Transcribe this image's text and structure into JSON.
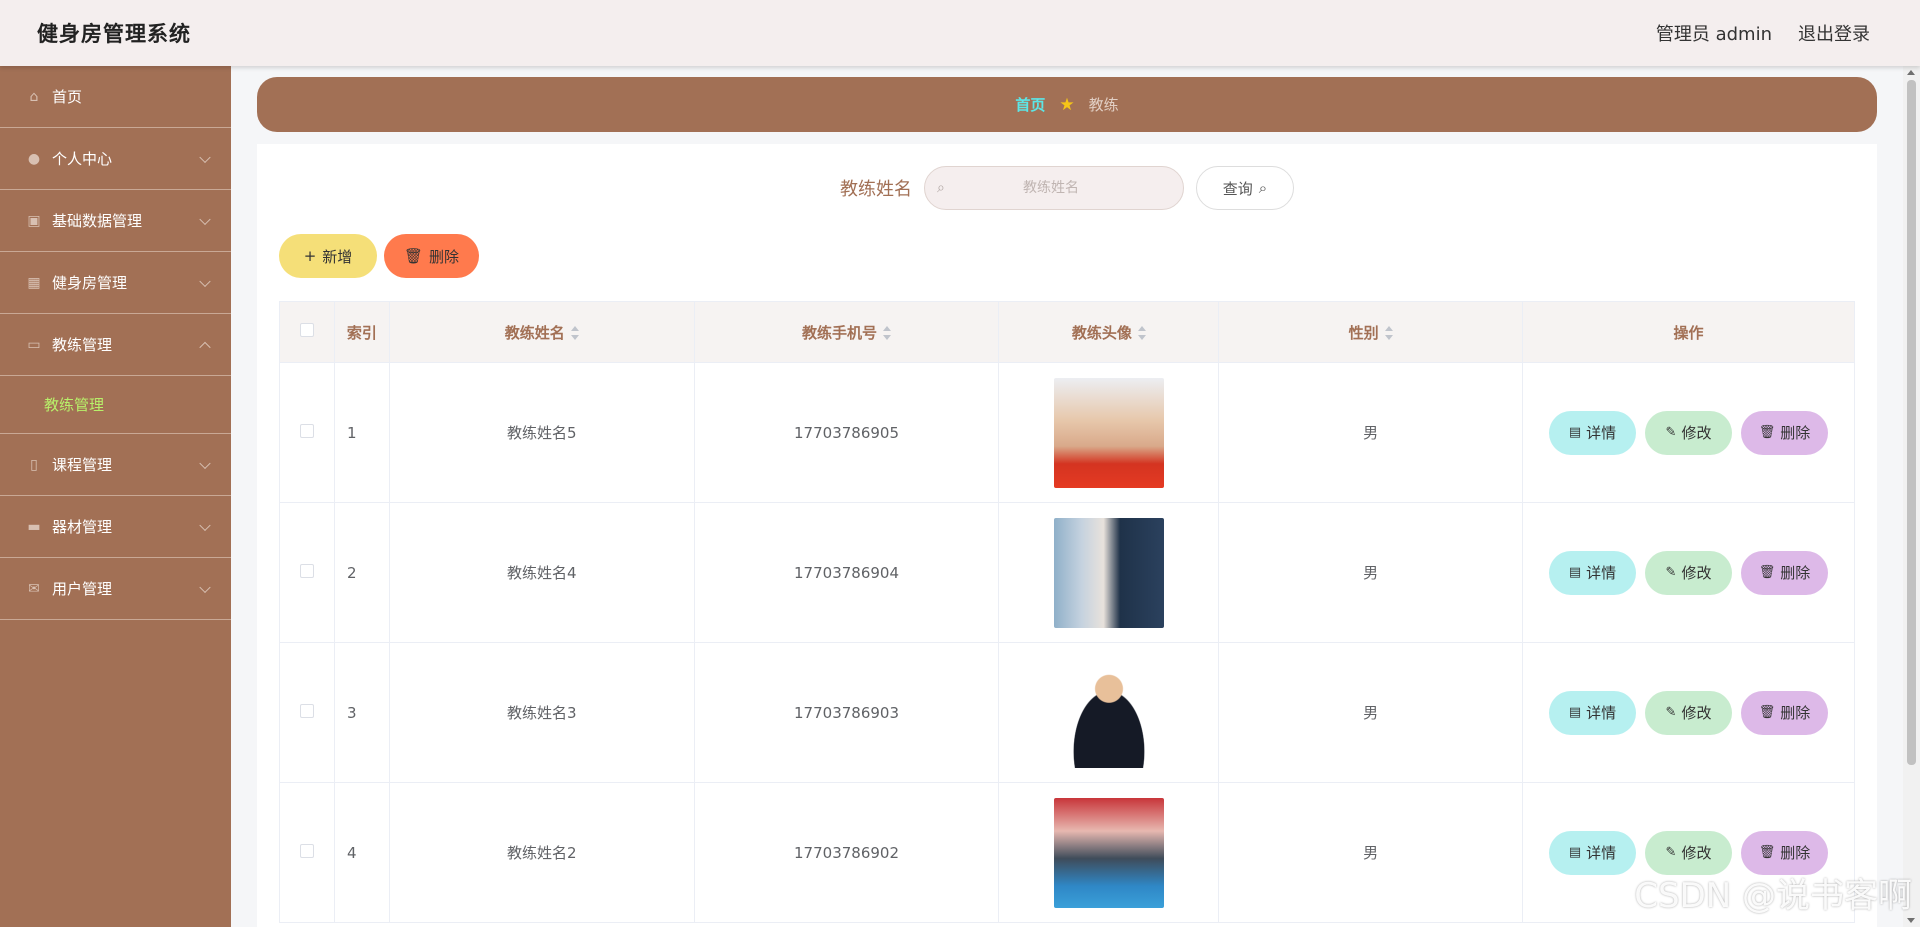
{
  "header": {
    "title": "健身房管理系统",
    "user": "管理员 admin",
    "logout": "退出登录"
  },
  "sidebar": {
    "items": [
      {
        "label": "首页",
        "icon": "home-icon"
      },
      {
        "label": "个人中心",
        "icon": "user-icon"
      },
      {
        "label": "基础数据管理",
        "icon": "briefcase-icon"
      },
      {
        "label": "健身房管理",
        "icon": "grid-icon"
      },
      {
        "label": "教练管理",
        "icon": "chat-icon"
      },
      {
        "label": "课程管理",
        "icon": "mic-icon"
      },
      {
        "label": "器材管理",
        "icon": "box-icon"
      },
      {
        "label": "用户管理",
        "icon": "mail-icon"
      }
    ],
    "submenu_active": "教练管理"
  },
  "breadcrumb": {
    "home": "首页",
    "current": "教练"
  },
  "search": {
    "label": "教练姓名",
    "placeholder": "教练姓名",
    "button": "查询"
  },
  "actions": {
    "add": "新增",
    "delete": "删除"
  },
  "table": {
    "headers": [
      "索引",
      "教练姓名",
      "教练手机号",
      "教练头像",
      "性别",
      "操作"
    ],
    "rows": [
      {
        "index": "1",
        "name": "教练姓名5",
        "phone": "17703786905",
        "gender": "男"
      },
      {
        "index": "2",
        "name": "教练姓名4",
        "phone": "17703786904",
        "gender": "男"
      },
      {
        "index": "3",
        "name": "教练姓名3",
        "phone": "17703786903",
        "gender": "男"
      },
      {
        "index": "4",
        "name": "教练姓名2",
        "phone": "17703786902",
        "gender": "男"
      }
    ],
    "ops": {
      "detail": "详情",
      "edit": "修改",
      "delete": "删除"
    }
  },
  "watermark": "CSDN @说书客啊"
}
